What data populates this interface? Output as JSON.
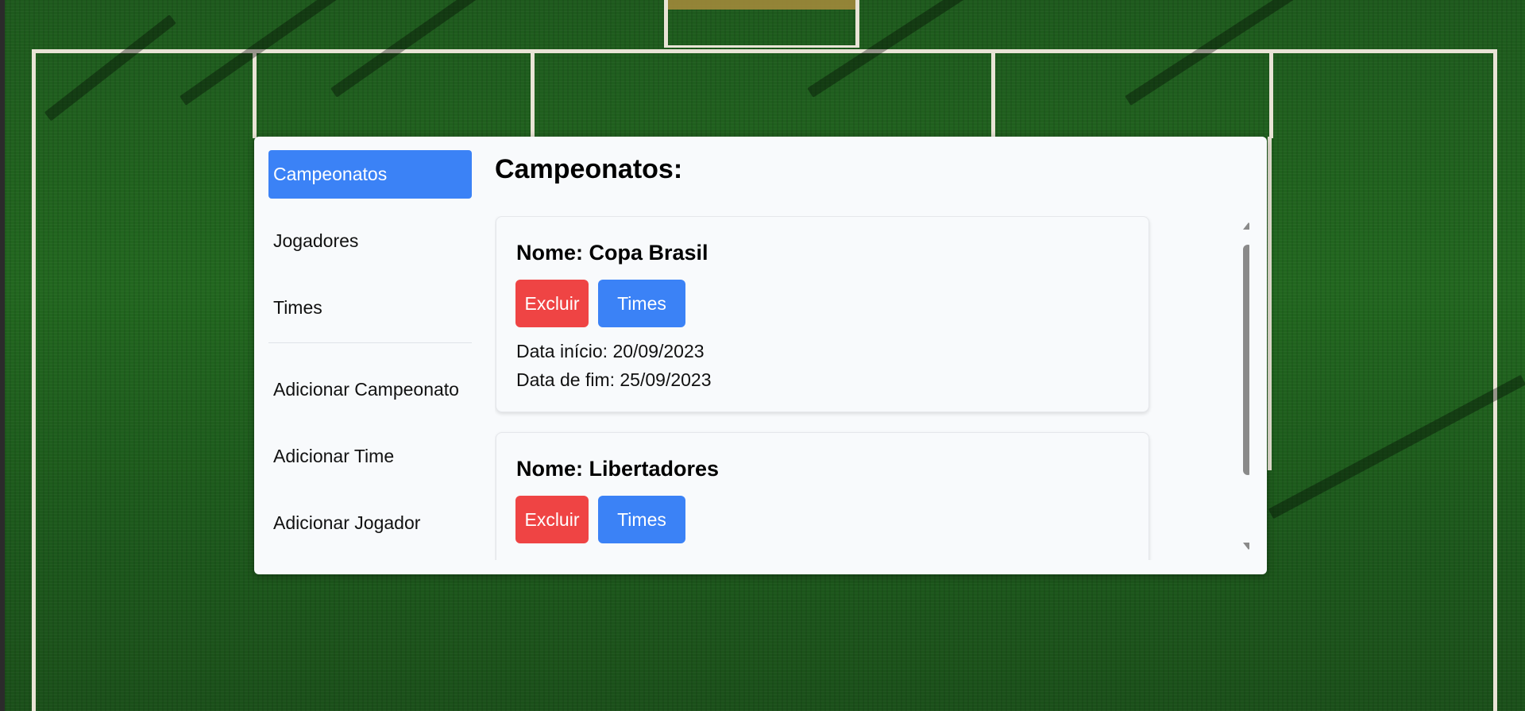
{
  "sidebar": {
    "items": [
      {
        "label": "Campeonatos",
        "active": true
      },
      {
        "label": "Jogadores",
        "active": false
      },
      {
        "label": "Times",
        "active": false
      }
    ],
    "actions": [
      {
        "label": "Adicionar Campeonato"
      },
      {
        "label": "Adicionar Time"
      },
      {
        "label": "Adicionar Jogador"
      }
    ]
  },
  "main": {
    "title": "Campeonatos:",
    "championships": [
      {
        "name": "Nome: Copa Brasil",
        "delete_label": "Excluir",
        "teams_label": "Times",
        "start": "Data início: 20/09/2023",
        "end": "Data de fim: 25/09/2023"
      },
      {
        "name": "Nome: Libertadores",
        "delete_label": "Excluir",
        "teams_label": "Times"
      }
    ]
  },
  "colors": {
    "accent": "#3b82f6",
    "danger": "#ef4444",
    "panel_bg": "#f8fafc"
  }
}
